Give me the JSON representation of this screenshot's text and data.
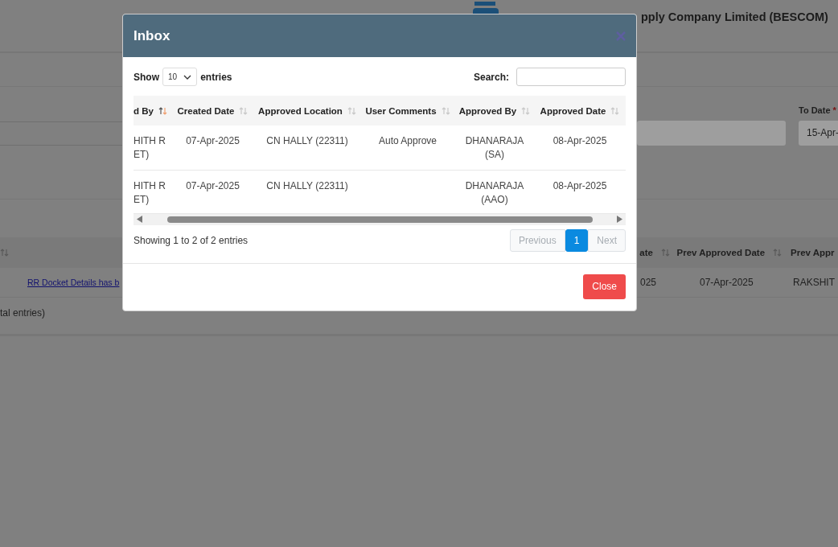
{
  "page": {
    "header_title": "pply Company Limited (BESCOM)",
    "to_date": {
      "label": "To Date",
      "required": true,
      "required_mark": "*",
      "value": "15-Apr-"
    },
    "table": {
      "columns": [
        {
          "label": "ate"
        },
        {
          "label": "Prev Approved Date"
        },
        {
          "label": "Prev Appr"
        }
      ],
      "row": {
        "link": "RR Docket Details has b",
        "cells": [
          "025",
          "07-Apr-2025",
          "RAKSHIT"
        ]
      },
      "info": "tal entries)"
    }
  },
  "modal": {
    "title": "Inbox",
    "length": {
      "label_before": "Show",
      "value": "10",
      "label_after": "entries"
    },
    "search": {
      "label": "Search:"
    },
    "columns": [
      {
        "label": "d By",
        "sorted": true
      },
      {
        "label": "Created Date",
        "sorted": false
      },
      {
        "label": "Approved Location",
        "sorted": false
      },
      {
        "label": "User Comments",
        "sorted": false
      },
      {
        "label": "Approved By",
        "sorted": false
      },
      {
        "label": "Approved Date",
        "sorted": false
      }
    ],
    "rows": [
      [
        "HITH R ET)",
        "07-Apr-2025",
        "CN HALLY (22311)",
        "Auto Approve",
        "DHANARAJA (SA)",
        "08-Apr-2025"
      ],
      [
        "HITH R ET)",
        "07-Apr-2025",
        "CN HALLY (22311)",
        null,
        "DHANARAJA (AAO)",
        "08-Apr-2025"
      ]
    ],
    "info": "Showing 1 to 2 of 2 entries",
    "pagination": [
      {
        "kind": "nav",
        "label": "Previous",
        "disabled": true
      },
      {
        "kind": "page",
        "label": "1",
        "selected": true
      },
      {
        "kind": "nav",
        "label": "Next",
        "disabled": true
      }
    ],
    "footer_button": "Close"
  }
}
